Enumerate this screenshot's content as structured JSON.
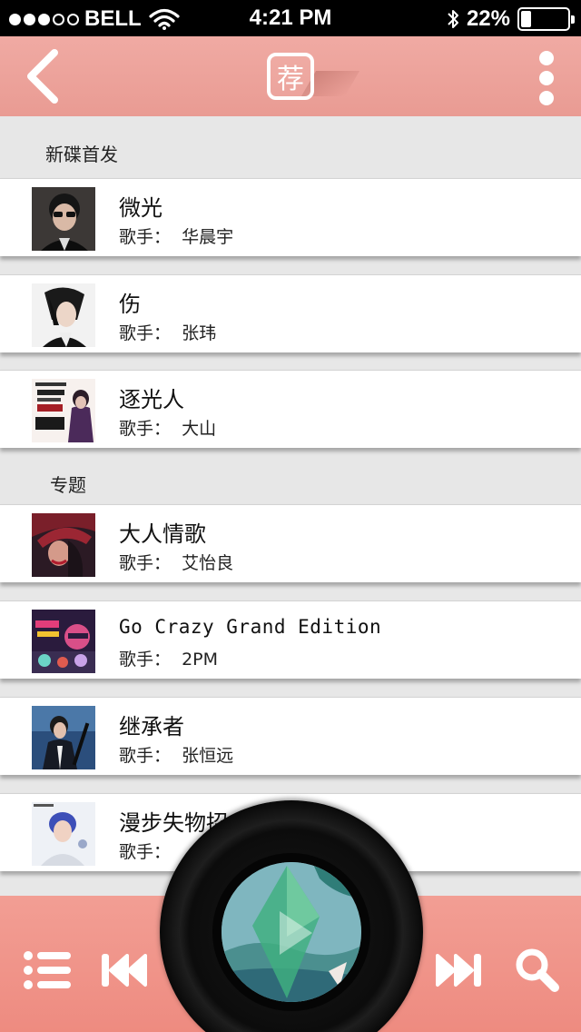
{
  "status_bar": {
    "signal_dots_filled": 3,
    "signal_dots_total": 5,
    "carrier": "BELL",
    "time": "4:21 PM",
    "battery": "22%",
    "battery_level": 0.22,
    "icons": [
      "wifi-icon",
      "bluetooth-icon",
      "battery-icon"
    ]
  },
  "header": {
    "logo_text": "荐",
    "icons": [
      "back-icon",
      "more-icon"
    ],
    "color": "#ec9f97"
  },
  "sections": [
    {
      "title": "新碟首发",
      "items": [
        {
          "title": "微光",
          "artist": "歌手：  华晨宇"
        },
        {
          "title": "伤",
          "artist": "歌手：  张玮"
        },
        {
          "title": "逐光人",
          "artist": "歌手：  大山"
        }
      ]
    },
    {
      "title": "专题",
      "items": [
        {
          "title": "大人情歌",
          "artist": "歌手：  艾怡良"
        },
        {
          "title": "Go Crazy Grand Edition",
          "artist": "歌手：  2PM"
        },
        {
          "title": "继承者",
          "artist": "歌手：  张恒远"
        },
        {
          "title": "漫步失物招",
          "artist": "歌手："
        }
      ]
    }
  ],
  "player": {
    "icons": [
      "playlist-icon",
      "previous-icon",
      "play-icon",
      "next-icon",
      "search-icon"
    ],
    "bar_color": "#ee8f85"
  }
}
